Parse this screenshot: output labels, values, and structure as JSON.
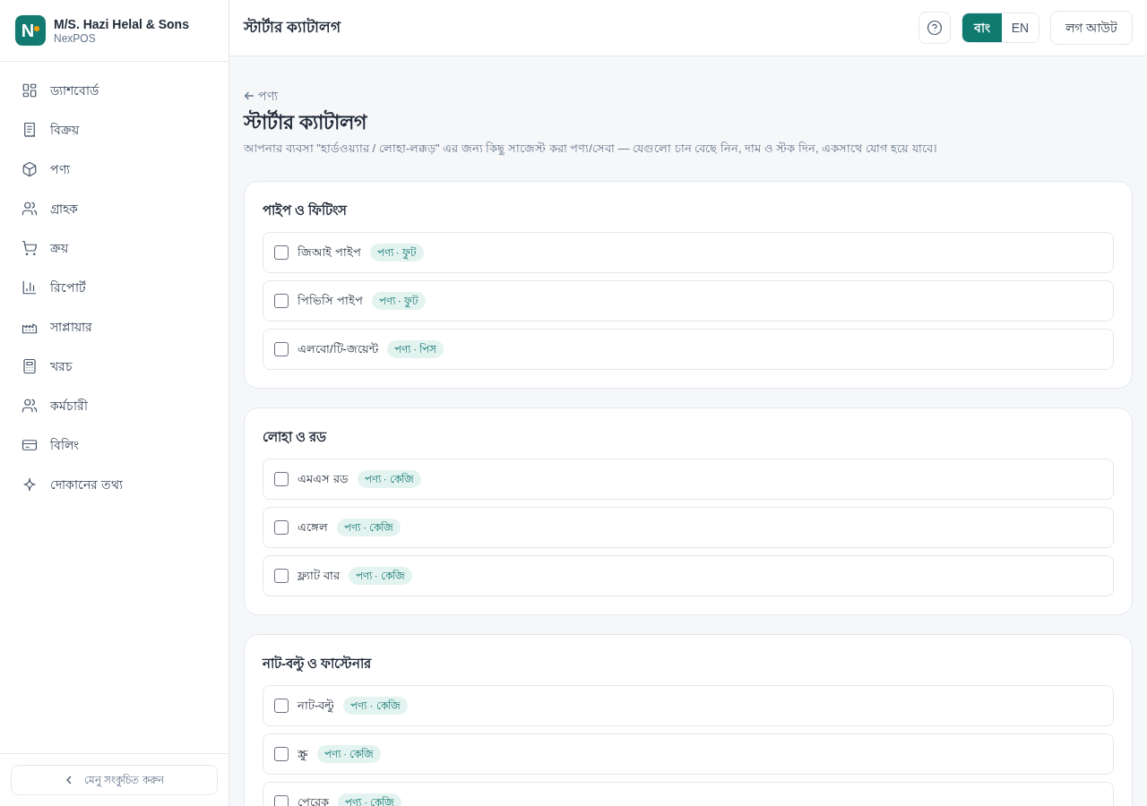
{
  "sidebar": {
    "logo": {
      "letter": "N"
    },
    "business_name": "M/S. Hazi Helal & Sons",
    "app_name": "NexPOS",
    "nav_items": [
      {
        "label": "ড্যাশবোর্ড"
      },
      {
        "label": "বিক্রয়"
      },
      {
        "label": "পণ্য"
      },
      {
        "label": "গ্রাহক"
      },
      {
        "label": "ক্রয়"
      },
      {
        "label": "রিপোর্ট"
      },
      {
        "label": "সাপ্লায়ার"
      },
      {
        "label": "খরচ"
      },
      {
        "label": "কর্মচারী"
      },
      {
        "label": "বিলিং"
      },
      {
        "label": "দোকানের তথ্য"
      }
    ],
    "collapse_button": "মেনু সংকুচিত করুন"
  },
  "header": {
    "title": "স্টার্টার ক্যাটালগ",
    "languages": [
      {
        "label": "বাং",
        "selected": true
      },
      {
        "label": "EN",
        "selected": false
      }
    ],
    "logout_button": "লগ আউট"
  },
  "page": {
    "breadcrumb": "পণ্য",
    "title": "স্টার্টার ক্যাটালগ",
    "description": "আপনার ব্যবসা \"হার্ডওয়্যার / লোহা-লক্কড়\" এর জন্য কিছু সাজেস্ট করা পণ্য/সেবা — যেগুলো চান বেছে নিন, দাম ও স্টক দিন, একসাথে যোগ হয়ে যাবে।",
    "sections": [
      {
        "title": "পাইপ ও ফিটিংস",
        "items": [
          {
            "name": "জিআই পাইপ",
            "badge": "পণ্য · ফুট",
            "checked": false
          },
          {
            "name": "পিভিসি পাইপ",
            "badge": "পণ্য · ফুট",
            "checked": false
          },
          {
            "name": "এলবো/টি-জয়েন্ট",
            "badge": "পণ্য · পিস",
            "checked": false
          }
        ]
      },
      {
        "title": "লোহা ও রড",
        "items": [
          {
            "name": "এমএস রড",
            "badge": "পণ্য · কেজি",
            "checked": false
          },
          {
            "name": "এঙ্গেল",
            "badge": "পণ্য · কেজি",
            "checked": false
          },
          {
            "name": "ফ্ল্যাট বার",
            "badge": "পণ্য · কেজি",
            "checked": false
          }
        ]
      },
      {
        "title": "নাট-বল্টু ও ফাস্টেনার",
        "items": [
          {
            "name": "নাট-বল্টু",
            "badge": "পণ্য · কেজি",
            "checked": false
          },
          {
            "name": "স্ক্রু",
            "badge": "পণ্য · কেজি",
            "checked": false
          },
          {
            "name": "পেরেক",
            "badge": "পণ্য · কেজি",
            "checked": false
          }
        ]
      }
    ]
  }
}
